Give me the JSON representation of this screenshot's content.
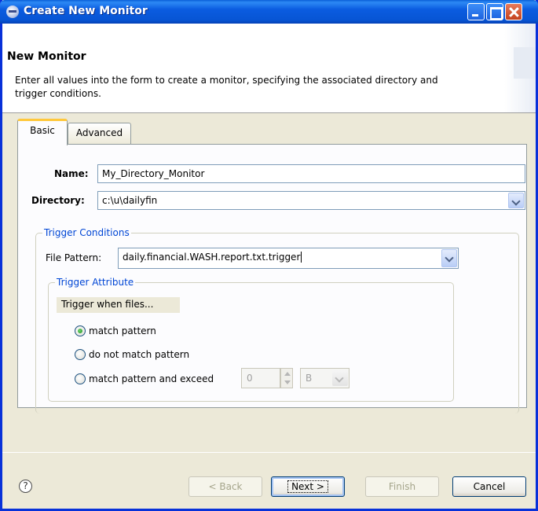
{
  "window": {
    "title": "Create New Monitor",
    "icon": "eclipse-icon"
  },
  "header": {
    "title": "New Monitor",
    "description": "Enter all values into the form to create a monitor, specifying the associated directory and trigger conditions."
  },
  "tabs": [
    {
      "label": "Basic",
      "selected": true
    },
    {
      "label": "Advanced",
      "selected": false
    }
  ],
  "form": {
    "name_label": "Name:",
    "name_value": "My_Directory_Monitor",
    "directory_label": "Directory:",
    "directory_value": "c:\\u\\dailyfin"
  },
  "trigger_conditions": {
    "title": "Trigger Conditions",
    "file_pattern_label": "File Pattern:",
    "file_pattern_value": "daily.financial.WASH.report.txt.trigger"
  },
  "trigger_attribute": {
    "title": "Trigger Attribute",
    "subtitle": "Trigger when files...",
    "options": [
      {
        "label": "match pattern",
        "checked": true
      },
      {
        "label": "do not match pattern",
        "checked": false
      },
      {
        "label": "match pattern and exceed",
        "checked": false
      }
    ],
    "size_value": "0",
    "unit_value": "B"
  },
  "footer": {
    "help": "?",
    "back_label": "< Back",
    "next_label": "Next >",
    "finish_label": "Finish",
    "cancel_label": "Cancel"
  }
}
